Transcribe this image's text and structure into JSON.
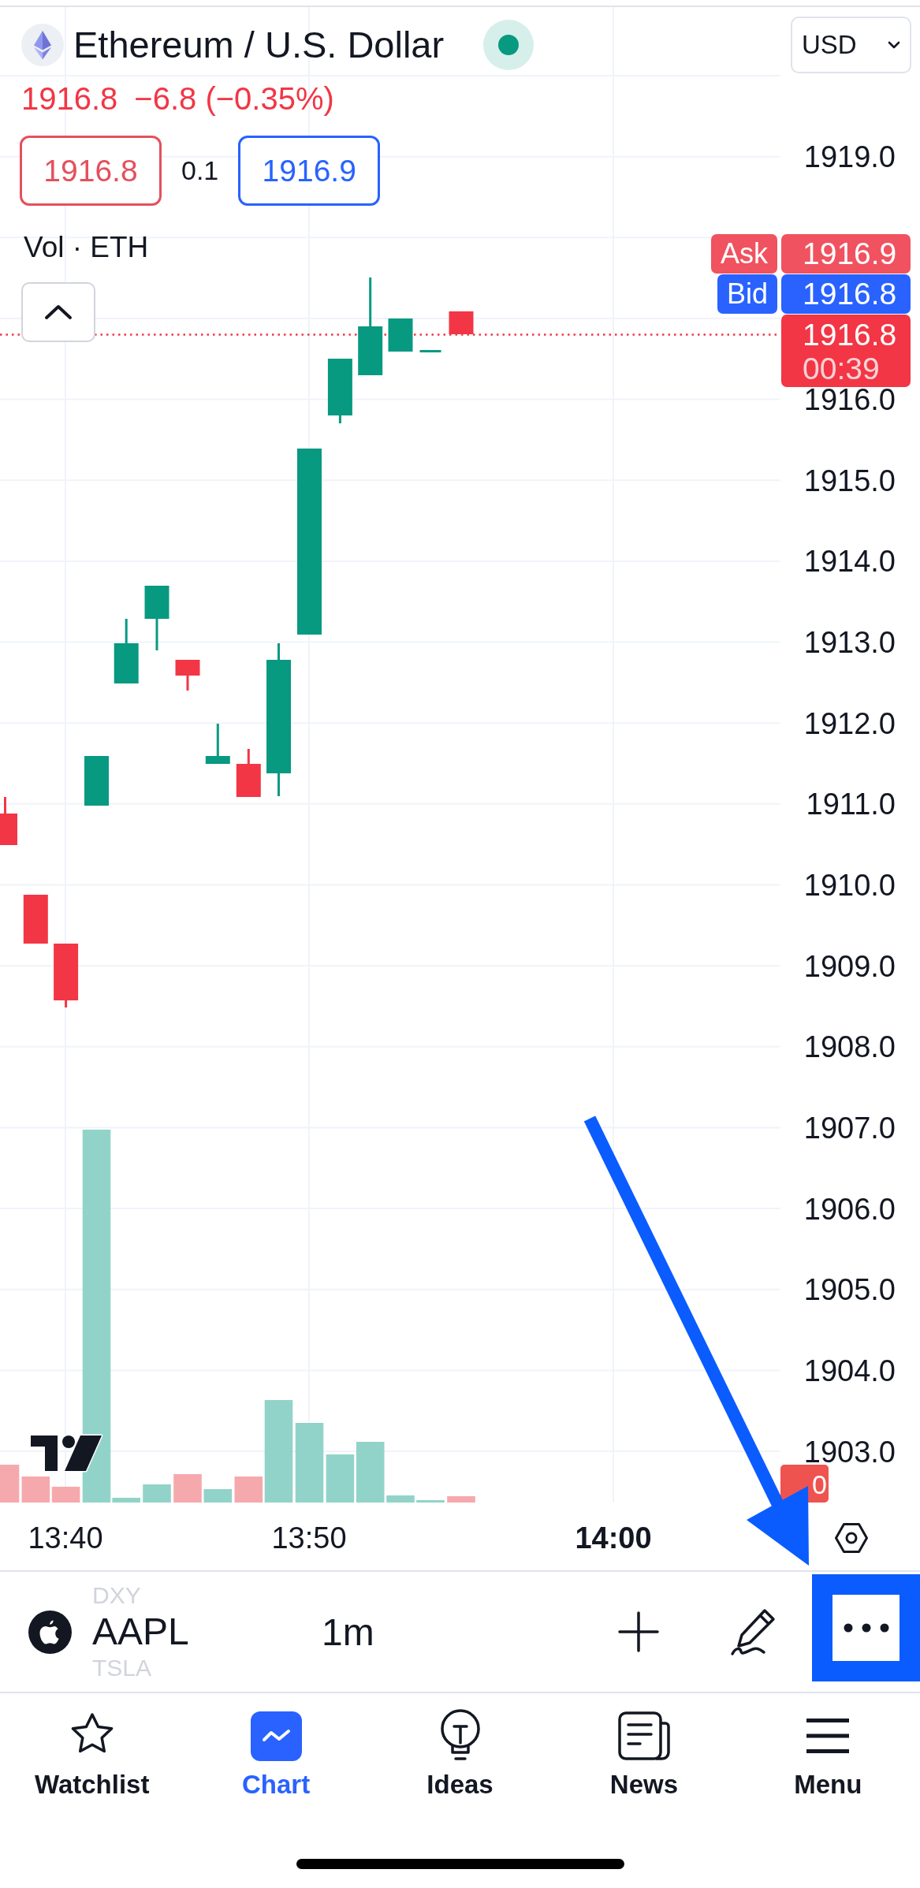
{
  "header": {
    "title": "Ethereum / U.S. Dollar",
    "market_open": true,
    "currency": "USD"
  },
  "quote": {
    "last": "1916.8",
    "change": "−6.8 (−0.35%)",
    "bid": "1916.8",
    "spread": "0.1",
    "ask": "1916.9"
  },
  "indicator": {
    "label": "Vol · ETH"
  },
  "price_axis": [
    "1919.0",
    "1916.0",
    "1915.0",
    "1914.0",
    "1913.0",
    "1912.0",
    "1911.0",
    "1910.0",
    "1909.0",
    "1908.0",
    "1907.0",
    "1906.0",
    "1905.0",
    "1904.0",
    "1903.0"
  ],
  "price_tags": [
    {
      "kind": "ask",
      "label": "Ask",
      "value": "1916.9"
    },
    {
      "kind": "bid",
      "label": "Bid",
      "value": "1916.8"
    },
    {
      "kind": "last",
      "value": "1916.8",
      "countdown": "00:39"
    }
  ],
  "volume_tag": "0",
  "time_axis": [
    {
      "label": "13:40",
      "major": false
    },
    {
      "label": "13:50",
      "major": false
    },
    {
      "label": "14:00",
      "major": true
    }
  ],
  "toolbar": {
    "symbols": [
      {
        "label": "DXY",
        "selected": false
      },
      {
        "label": "AAPL",
        "selected": true
      },
      {
        "label": "TSLA",
        "selected": false
      }
    ],
    "interval": "1m"
  },
  "tabs": [
    {
      "label": "Watchlist",
      "selected": false
    },
    {
      "label": "Chart",
      "selected": true
    },
    {
      "label": "Ideas",
      "selected": false
    },
    {
      "label": "News",
      "selected": false
    },
    {
      "label": "Menu",
      "selected": false
    }
  ]
}
